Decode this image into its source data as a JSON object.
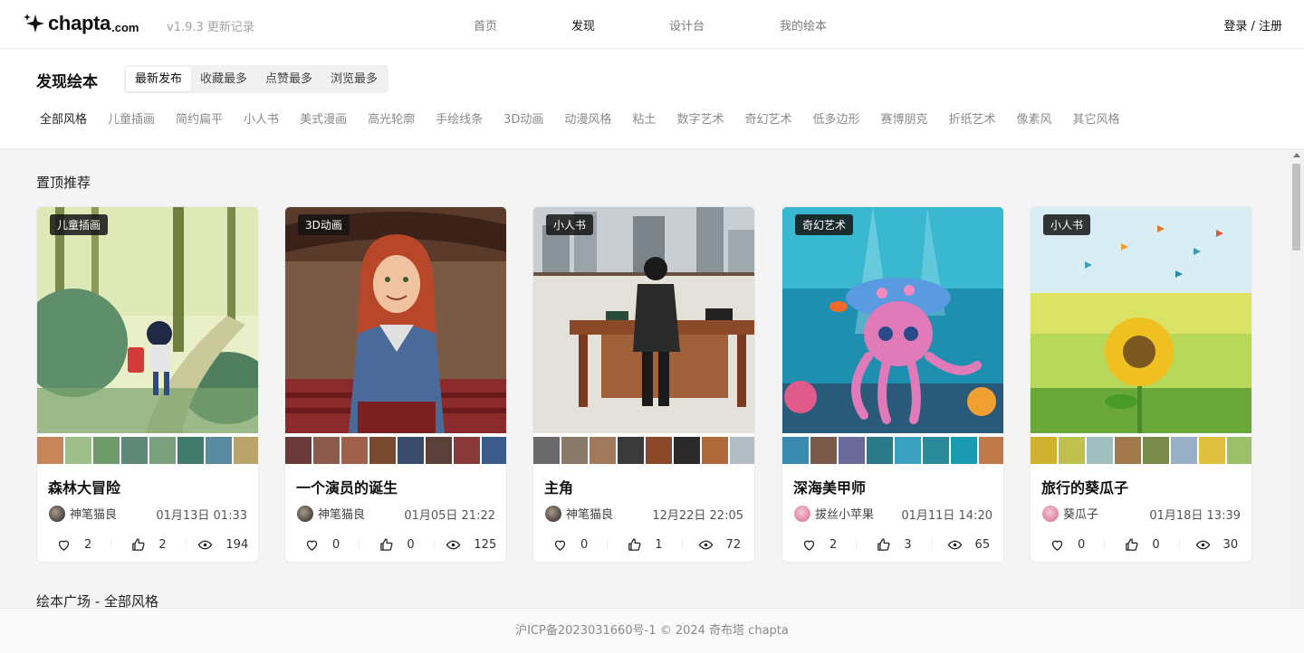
{
  "header": {
    "logo_text": "chapta",
    "logo_suffix": ".com",
    "version": "v1.9.3 更新记录",
    "nav": [
      "首页",
      "发现",
      "设计台",
      "我的绘本"
    ],
    "active_nav": "发现",
    "login": "登录 / 注册"
  },
  "filter": {
    "title": "发现绘本",
    "sort_tabs": [
      "最新发布",
      "收藏最多",
      "点赞最多",
      "浏览最多"
    ],
    "active_sort": "最新发布",
    "styles": [
      "全部风格",
      "儿童插画",
      "简约扁平",
      "小人书",
      "美式漫画",
      "高光轮廓",
      "手绘线条",
      "3D动画",
      "动漫风格",
      "粘土",
      "数字艺术",
      "奇幻艺术",
      "低多边形",
      "赛博朋克",
      "折纸艺术",
      "像素风",
      "其它风格"
    ],
    "active_style": "全部风格"
  },
  "sections": {
    "featured": "置顶推荐",
    "plaza": "绘本广场 - 全部风格"
  },
  "cards": [
    {
      "tag": "儿童插画",
      "title": "森林大冒险",
      "author": "神笔猫良",
      "date": "01月13日 01:33",
      "favorites": "2",
      "likes": "2",
      "views": "194"
    },
    {
      "tag": "3D动画",
      "title": "一个演员的诞生",
      "author": "神笔猫良",
      "date": "01月05日 21:22",
      "favorites": "0",
      "likes": "0",
      "views": "125"
    },
    {
      "tag": "小人书",
      "title": "主角",
      "author": "神笔猫良",
      "date": "12月22日 22:05",
      "favorites": "0",
      "likes": "1",
      "views": "72"
    },
    {
      "tag": "奇幻艺术",
      "title": "深海美甲师",
      "author": "拔丝小苹果",
      "date": "01月11日 14:20",
      "favorites": "2",
      "likes": "3",
      "views": "65"
    },
    {
      "tag": "小人书",
      "title": "旅行的葵瓜子",
      "author": "葵瓜子",
      "date": "01月18日 13:39",
      "favorites": "0",
      "likes": "0",
      "views": "30"
    }
  ],
  "footer": "沪ICP备2023031660号-1 © 2024 奇布塔 chapta",
  "colors": {
    "accent": "#111111",
    "muted": "#8a8a8a",
    "background": "#f4f4f4"
  }
}
